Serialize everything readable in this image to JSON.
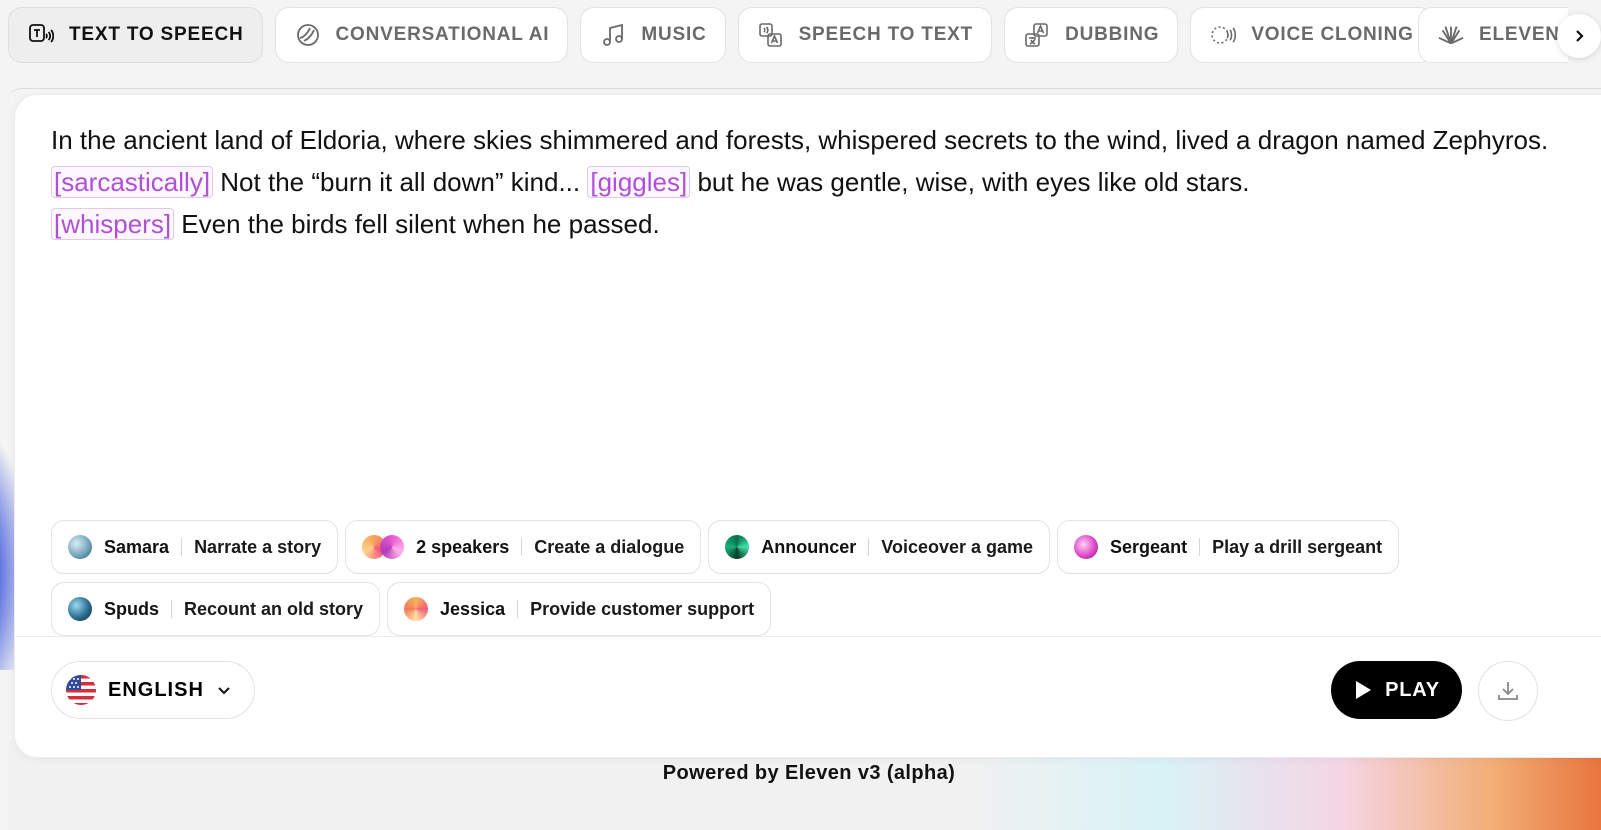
{
  "tabs": [
    {
      "label": "TEXT TO SPEECH",
      "icon": "text-to-speech-icon",
      "active": true
    },
    {
      "label": "CONVERSATIONAL AI",
      "icon": "conversational-ai-icon",
      "active": false
    },
    {
      "label": "MUSIC",
      "icon": "music-note-icon",
      "active": false
    },
    {
      "label": "SPEECH TO TEXT",
      "icon": "speech-to-text-icon",
      "active": false
    },
    {
      "label": "DUBBING",
      "icon": "dubbing-icon",
      "active": false
    },
    {
      "label": "VOICE CLONING",
      "icon": "voice-cloning-icon",
      "active": false
    },
    {
      "label": "ELEVEN",
      "icon": "eleven-icon",
      "active": false
    }
  ],
  "editor": {
    "p1": "In the ancient land of Eldoria, where skies shimmered and forests, whispered secrets to the wind, lived a dragon named Zephyros.",
    "tag1": "[sarcastically]",
    "p2": "Not the “burn it all down” kind...",
    "tag2": "[giggles]",
    "p3": "but he was gentle, wise, with eyes like old stars.",
    "tag3": "[whispers]",
    "p4": "Even the birds fell silent when he passed."
  },
  "suggestions": [
    {
      "voice": "Samara",
      "action": "Narrate a story"
    },
    {
      "voice": "2 speakers",
      "action": "Create a dialogue"
    },
    {
      "voice": "Announcer",
      "action": "Voiceover a game"
    },
    {
      "voice": "Sergeant",
      "action": "Play a drill sergeant"
    },
    {
      "voice": "Spuds",
      "action": "Recount an old story"
    },
    {
      "voice": "Jessica",
      "action": "Provide customer support"
    }
  ],
  "language": {
    "label": "ENGLISH",
    "flag": "us-flag-icon"
  },
  "play_label": "PLAY",
  "footer": "Powered by Eleven v3 (alpha)",
  "colors": {
    "tag": "#b14fd6",
    "play_bg": "#000000",
    "accent_orange": "#e8703a"
  }
}
